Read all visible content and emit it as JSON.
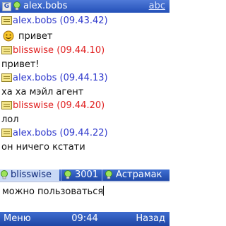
{
  "title_bar": {
    "app_icon_letter": "G",
    "contact_name": "alex.bobs",
    "input_mode": "abc"
  },
  "messages": [
    {
      "sender": "alex.bobs",
      "time": "(09.43.42)",
      "text": "",
      "color": "#2e38cc"
    },
    {
      "sender": "blisswise",
      "time": "(09.44.10)",
      "text": "привет!",
      "color": "#e02020"
    },
    {
      "sender": "alex.bobs",
      "time": "(09.44.13)",
      "text": "ха ха мэйл агент",
      "color": "#2e38cc"
    },
    {
      "sender": "blisswise",
      "time": "(09.44.20)",
      "text": "лол",
      "color": "#e02020"
    },
    {
      "sender": "alex.bobs",
      "time": "(09.44.22)",
      "text": "он ничего кстати",
      "color": "#2e38cc"
    }
  ],
  "first_message_smiley_text": "привет",
  "tabs": [
    {
      "label": "blisswise",
      "active": true
    },
    {
      "label": "3001",
      "active": false
    },
    {
      "label": "Астрамак",
      "active": false
    }
  ],
  "compose": {
    "value": "можно пользоваться"
  },
  "softkeys": {
    "left": "Меню",
    "clock": "09:44",
    "right": "Назад"
  }
}
